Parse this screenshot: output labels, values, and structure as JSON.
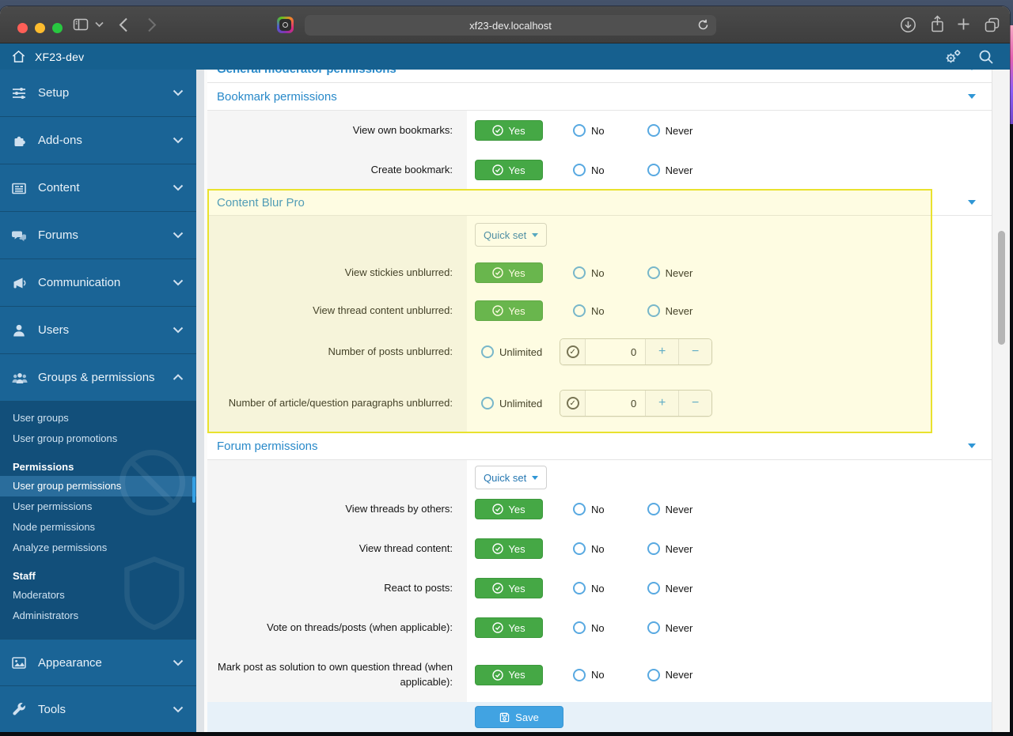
{
  "browser": {
    "url": "xf23-dev.localhost",
    "toolbar_icons": [
      "sidebar-toggle-icon",
      "tab-chevron-icon",
      "back-icon",
      "forward-icon",
      "extension-icon",
      "reload-icon",
      "downloads-icon",
      "share-icon",
      "new-tab-icon",
      "tab-overview-icon"
    ]
  },
  "admin_header": {
    "title": "XF23-dev",
    "icons": [
      "home-icon",
      "gears-icon",
      "search-icon"
    ]
  },
  "sidebar": {
    "items": [
      {
        "label": "Setup",
        "icon": "sliders-icon"
      },
      {
        "label": "Add-ons",
        "icon": "puzzle-icon"
      },
      {
        "label": "Content",
        "icon": "newspaper-icon"
      },
      {
        "label": "Forums",
        "icon": "comments-icon"
      },
      {
        "label": "Communication",
        "icon": "megaphone-icon"
      },
      {
        "label": "Users",
        "icon": "user-icon"
      },
      {
        "label": "Groups & permissions",
        "icon": "users-group-icon",
        "expanded": true
      }
    ],
    "groups_submenu": {
      "top_items": [
        "User groups",
        "User group promotions"
      ],
      "permissions_header": "Permissions",
      "permissions_items": [
        "User group permissions",
        "User permissions",
        "Node permissions",
        "Analyze permissions"
      ],
      "selected_item": "User group permissions",
      "staff_header": "Staff",
      "staff_items": [
        "Moderators",
        "Administrators"
      ]
    },
    "bottom_items": [
      {
        "label": "Appearance",
        "icon": "image-icon"
      },
      {
        "label": "Tools",
        "icon": "wrench-icon"
      }
    ]
  },
  "options": {
    "yes": "Yes",
    "no": "No",
    "never": "Never",
    "unlimited": "Unlimited"
  },
  "sections": [
    {
      "title": "General moderator permissions"
    },
    {
      "title": "Bookmark permissions",
      "rows": [
        {
          "label": "View own bookmarks:",
          "selected": "Yes"
        },
        {
          "label": "Create bookmark:",
          "selected": "Yes"
        }
      ]
    },
    {
      "title": "Content Blur Pro",
      "highlighted": true,
      "quick_set_label": "Quick set",
      "rows": [
        {
          "label": "View stickies unblurred:",
          "selected": "Yes"
        },
        {
          "label": "View thread content unblurred:",
          "selected": "Yes"
        },
        {
          "label": "Number of posts unblurred:",
          "type": "number",
          "unlimited_label": "Unlimited",
          "value": "0"
        },
        {
          "label": "Number of article/question paragraphs unblurred:",
          "type": "number",
          "unlimited_label": "Unlimited",
          "value": "0"
        }
      ]
    },
    {
      "title": "Forum permissions",
      "quick_set_label": "Quick set",
      "rows": [
        {
          "label": "View threads by others:",
          "selected": "Yes"
        },
        {
          "label": "View thread content:",
          "selected": "Yes"
        },
        {
          "label": "React to posts:",
          "selected": "Yes"
        },
        {
          "label": "Vote on threads/posts (when applicable):",
          "selected": "Yes"
        },
        {
          "label": "Mark post as solution to own question thread (when applicable):",
          "selected": "Yes"
        }
      ]
    }
  ],
  "footer": {
    "save_label": "Save"
  },
  "colors": {
    "header_blue": "#16608f",
    "sidebar_blue": "#1a6496",
    "submenu_blue": "#124f7a",
    "accent_blue": "#2889c9",
    "yes_green": "#45a845",
    "save_blue": "#41a3e2",
    "highlight_yellow": "#e9e22e"
  }
}
